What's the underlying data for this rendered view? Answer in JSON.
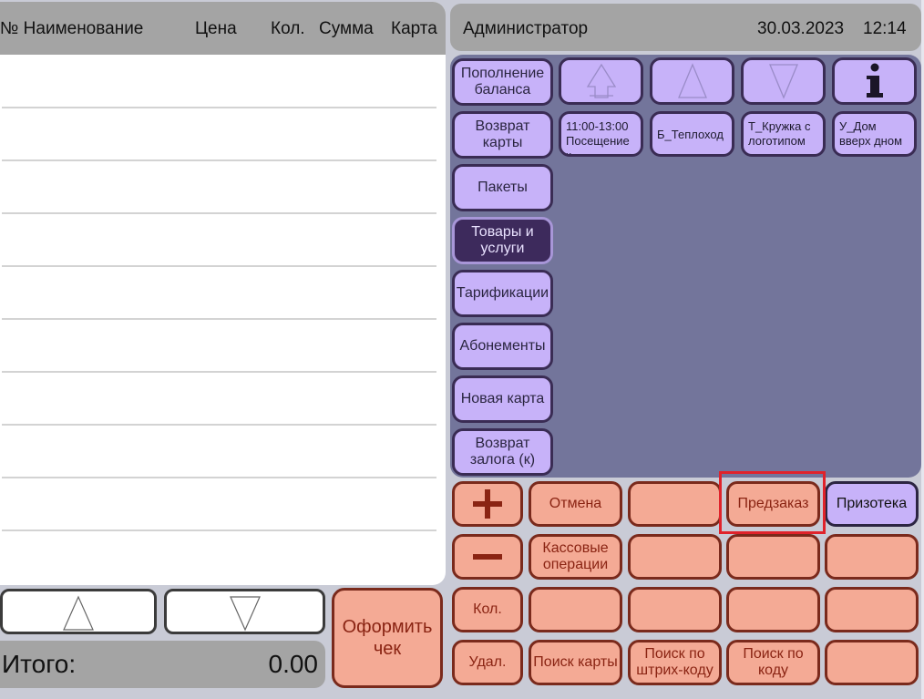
{
  "receipt": {
    "columns": [
      "№ Наименование",
      "Цена",
      "Кол.",
      "Сумма",
      "Карта"
    ]
  },
  "total": {
    "label": "Итого:",
    "value": "0.00"
  },
  "checkout_label": "Оформить чек",
  "topbar": {
    "user": "Администратор",
    "date": "30.03.2023",
    "time": "12:14"
  },
  "menu": {
    "items": [
      "Пополнение баланса",
      "Возврат карты",
      "Пакеты",
      "Товары и услуги",
      "Тарификации",
      "Абонементы",
      "Новая карта",
      "Возврат залога (к)"
    ],
    "active": "Товары и услуги"
  },
  "catalog": {
    "nav_icons": [
      "top-arrow-icon",
      "arrow-up-icon",
      "arrow-down-icon",
      "info-icon"
    ],
    "products": [
      {
        "line1": "11:00-13:00",
        "line2": "Посещение к"
      },
      {
        "line1": "Б_Теплоход",
        "line2": ""
      },
      {
        "line1": "Т_Кружка с",
        "line2": "логотипом"
      },
      {
        "line1": "У_Дом",
        "line2": "вверх дном"
      }
    ]
  },
  "actions": {
    "cancel": "Отмена",
    "preorder": "Предзаказ",
    "prize": "Призотека",
    "cash_ops": "Кассовые операции",
    "qty": "Кол.",
    "delete": "Удал.",
    "find_card": "Поиск карты",
    "find_barcode": "Поиск по штрих-коду",
    "find_code": "Поиск по коду"
  },
  "colors": {
    "menu_button": "#c7b2f9",
    "menu_active": "#3d2a5c",
    "catalog_bg": "#73759b",
    "action_button": "#f4aa95",
    "highlight": "#e0232b"
  }
}
